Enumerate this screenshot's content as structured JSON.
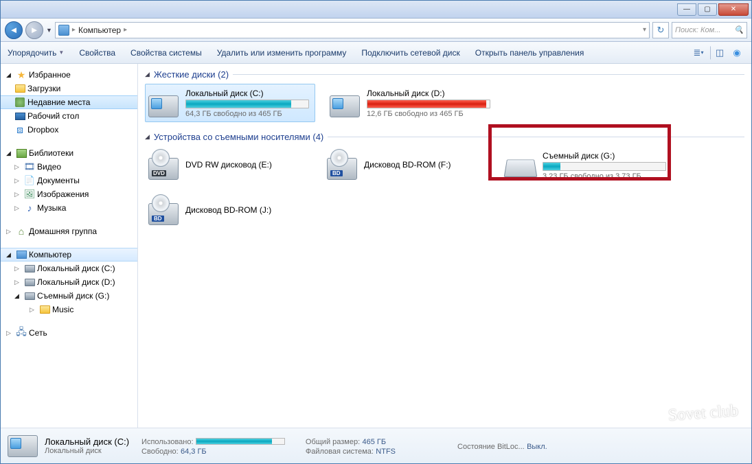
{
  "titlebar": {
    "text": ""
  },
  "breadcrumb": {
    "location": "Компьютер",
    "sep": "▸"
  },
  "search": {
    "placeholder": "Поиск: Ком..."
  },
  "toolbar": {
    "organize": "Упорядочить",
    "properties": "Свойства",
    "system_props": "Свойства системы",
    "uninstall": "Удалить или изменить программу",
    "map_drive": "Подключить сетевой диск",
    "control_panel": "Открыть панель управления"
  },
  "sidebar": {
    "favorites": "Избранное",
    "downloads": "Загрузки",
    "recent": "Недавние места",
    "desktop": "Рабочий стол",
    "dropbox": "Dropbox",
    "libraries": "Библиотеки",
    "video": "Видео",
    "documents": "Документы",
    "images": "Изображения",
    "music": "Музыка",
    "homegroup": "Домашняя группа",
    "computer": "Компьютер",
    "disk_c": "Локальный диск (C:)",
    "disk_d": "Локальный диск (D:)",
    "disk_g": "Съемный диск (G:)",
    "music_folder": "Music",
    "network": "Сеть"
  },
  "groups": {
    "hdd": "Жесткие диски (2)",
    "removable": "Устройства со съемными носителями (4)"
  },
  "drives": {
    "c": {
      "name": "Локальный диск (C:)",
      "free": "64,3 ГБ свободно из 465 ГБ",
      "fill": 86
    },
    "d": {
      "name": "Локальный диск (D:)",
      "free": "12,6 ГБ свободно из 465 ГБ",
      "fill": 97
    },
    "e": {
      "name": "DVD RW дисковод (E:)"
    },
    "f": {
      "name": "Дисковод BD-ROM (F:)"
    },
    "j": {
      "name": "Дисковод BD-ROM (J:)"
    },
    "g": {
      "name": "Съемный диск (G:)",
      "free": "3,23 ГБ свободно из 3,73 ГБ",
      "fill": 14
    }
  },
  "details": {
    "name": "Локальный диск (C:)",
    "type": "Локальный диск",
    "used_label": "Использовано:",
    "free_label": "Свободно:",
    "free_val": "64,3 ГБ",
    "total_label": "Общий размер:",
    "total_val": "465 ГБ",
    "fs_label": "Файловая система:",
    "fs_val": "NTFS",
    "bitlocker_label": "Состояние BitLoc...",
    "bitlocker_val": "Выкл.",
    "fill": 86
  },
  "watermark": "Sovet club"
}
